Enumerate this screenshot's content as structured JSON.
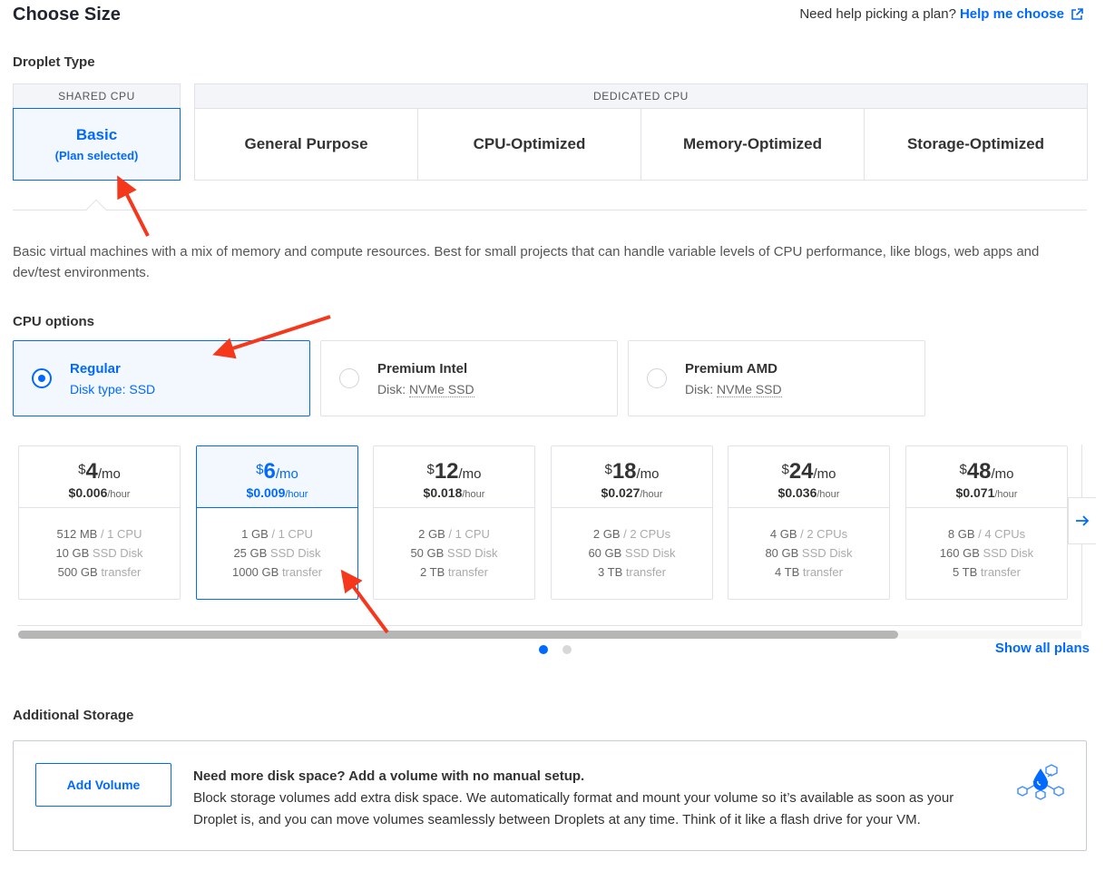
{
  "header": {
    "title": "Choose Size",
    "help_text": "Need help picking a plan?",
    "help_link": "Help me choose"
  },
  "droplet_type": {
    "label": "Droplet Type",
    "shared_header": "SHARED CPU",
    "dedicated_header": "DEDICATED CPU",
    "basic": {
      "label": "Basic",
      "sub": "(Plan selected)"
    },
    "dedicated_options": [
      "General Purpose",
      "CPU-Optimized",
      "Memory-Optimized",
      "Storage-Optimized"
    ],
    "description": "Basic virtual machines with a mix of memory and compute resources. Best for small projects that can handle variable levels of CPU performance, like blogs, web apps and dev/test environments."
  },
  "cpu_options": {
    "label": "CPU options",
    "items": [
      {
        "title": "Regular",
        "sub": "Disk type: SSD",
        "selected": true
      },
      {
        "title": "Premium Intel",
        "sub_prefix": "Disk:",
        "sub_value": "NVMe SSD",
        "selected": false
      },
      {
        "title": "Premium AMD",
        "sub_prefix": "Disk:",
        "sub_value": "NVMe SSD",
        "selected": false
      }
    ]
  },
  "plans": [
    {
      "currency": "$",
      "price": "4",
      "per": "/mo",
      "hourly": "$0.006",
      "hourly_unit": "/hour",
      "memory": "512 MB",
      "cpu": "/ 1 CPU",
      "disk": "10 GB",
      "disk_label": "SSD Disk",
      "transfer": "500 GB",
      "transfer_label": "transfer",
      "selected": false
    },
    {
      "currency": "$",
      "price": "6",
      "per": "/mo",
      "hourly": "$0.009",
      "hourly_unit": "/hour",
      "memory": "1 GB",
      "cpu": "/ 1 CPU",
      "disk": "25 GB",
      "disk_label": "SSD Disk",
      "transfer": "1000 GB",
      "transfer_label": "transfer",
      "selected": true
    },
    {
      "currency": "$",
      "price": "12",
      "per": "/mo",
      "hourly": "$0.018",
      "hourly_unit": "/hour",
      "memory": "2 GB",
      "cpu": "/ 1 CPU",
      "disk": "50 GB",
      "disk_label": "SSD Disk",
      "transfer": "2 TB",
      "transfer_label": "transfer",
      "selected": false
    },
    {
      "currency": "$",
      "price": "18",
      "per": "/mo",
      "hourly": "$0.027",
      "hourly_unit": "/hour",
      "memory": "2 GB",
      "cpu": "/ 2 CPUs",
      "disk": "60 GB",
      "disk_label": "SSD Disk",
      "transfer": "3 TB",
      "transfer_label": "transfer",
      "selected": false
    },
    {
      "currency": "$",
      "price": "24",
      "per": "/mo",
      "hourly": "$0.036",
      "hourly_unit": "/hour",
      "memory": "4 GB",
      "cpu": "/ 2 CPUs",
      "disk": "80 GB",
      "disk_label": "SSD Disk",
      "transfer": "4 TB",
      "transfer_label": "transfer",
      "selected": false
    },
    {
      "currency": "$",
      "price": "48",
      "per": "/mo",
      "hourly": "$0.071",
      "hourly_unit": "/hour",
      "memory": "8 GB",
      "cpu": "/ 4 CPUs",
      "disk": "160 GB",
      "disk_label": "SSD Disk",
      "transfer": "5 TB",
      "transfer_label": "transfer",
      "selected": false
    }
  ],
  "plans_nav": {
    "show_all": "Show all plans",
    "next_icon": "arrow-right-icon",
    "page": 1,
    "pages": 2
  },
  "additional_storage": {
    "label": "Additional Storage",
    "button": "Add Volume",
    "headline": "Need more disk space? Add a volume with no manual setup.",
    "body": "Block storage volumes add extra disk space. We automatically format and mount your volume so it’s available as soon as your Droplet is, and you can move volumes seamlessly between Droplets at any time. Think of it like a flash drive for your VM.",
    "icon": "volume-illustration-icon"
  },
  "colors": {
    "accent": "#0069ff",
    "annotation": "#f5371c",
    "border": "#dfe3e8"
  }
}
